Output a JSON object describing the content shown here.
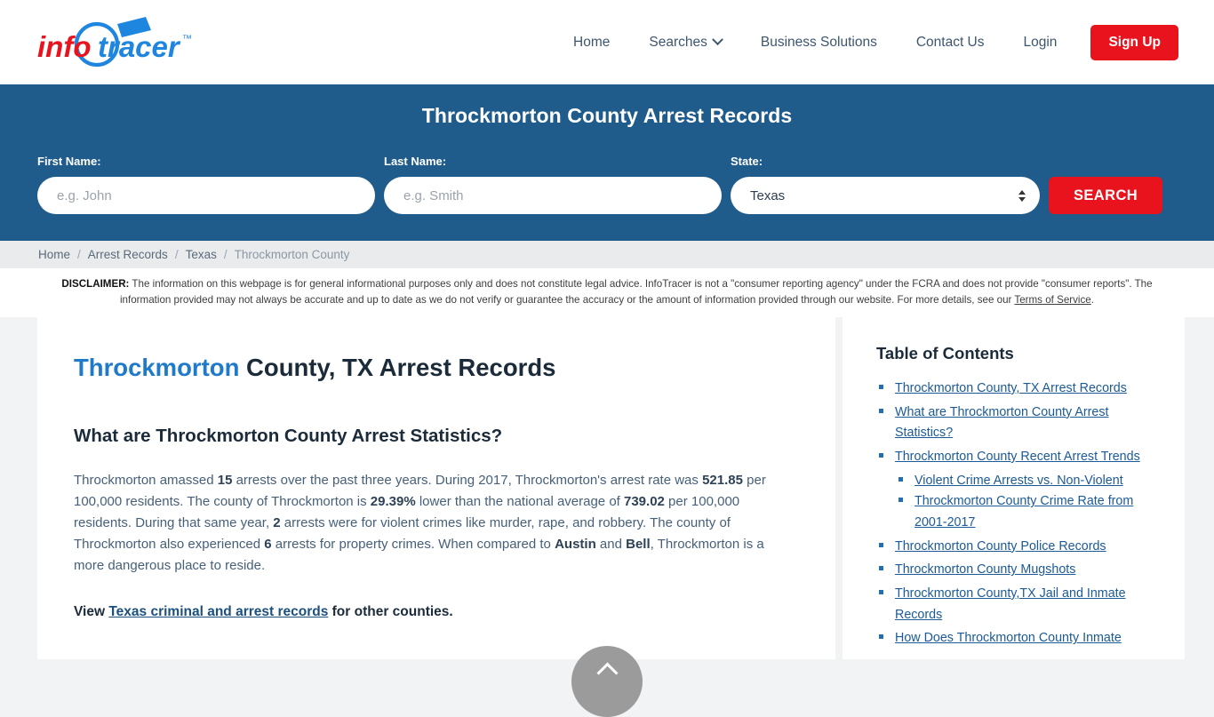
{
  "brand": {
    "name_part1": "info",
    "name_part2": "tracer",
    "trademark": "™",
    "color_red": "#e8131d",
    "color_blue": "#1f86e0"
  },
  "nav": {
    "items": [
      {
        "label": "Home",
        "has_caret": false
      },
      {
        "label": "Searches",
        "has_caret": true
      },
      {
        "label": "Business Solutions",
        "has_caret": false
      },
      {
        "label": "Contact Us",
        "has_caret": false
      },
      {
        "label": "Login",
        "has_caret": false
      }
    ],
    "signup_label": "Sign Up"
  },
  "hero": {
    "title": "Throckmorton County Arrest Records",
    "background_color": "#1f5c8b",
    "first_name": {
      "label": "First Name:",
      "value": "",
      "placeholder": "e.g. John"
    },
    "last_name": {
      "label": "Last Name:",
      "value": "",
      "placeholder": "e.g. Smith"
    },
    "state": {
      "label": "State:",
      "value": "Texas"
    },
    "search_label": "SEARCH"
  },
  "breadcrumb": {
    "items": [
      "Home",
      "Arrest Records",
      "Texas",
      "Throckmorton County"
    ],
    "separator": "/"
  },
  "disclaimer": {
    "label": "DISCLAIMER:",
    "text": " The information on this webpage is for general informational purposes only and does not constitute legal advice. InfoTracer is not a \"consumer reporting agency\" under the FCRA and does not provide \"consumer reports\". The information provided may not always be accurate and up to date as we do not verify or guarantee the accuracy or the amount of information provided through our website. For more details, see our ",
    "link": "Terms of Service",
    "tail": "."
  },
  "main": {
    "h1_highlight": "Throckmorton",
    "h1_rest": " County, TX Arrest Records",
    "h2": "What are Throckmorton County Arrest Statistics?",
    "paragraph_parts": [
      {
        "t": "Throckmorton amassed ",
        "b": false
      },
      {
        "t": "15",
        "b": true
      },
      {
        "t": " arrests over the past three years. During 2017, Throckmorton's arrest rate was ",
        "b": false
      },
      {
        "t": "521.85",
        "b": true
      },
      {
        "t": " per 100,000 residents. The county of Throckmorton is ",
        "b": false
      },
      {
        "t": "29.39%",
        "b": true
      },
      {
        "t": " lower than the national average of ",
        "b": false
      },
      {
        "t": "739.02",
        "b": true
      },
      {
        "t": " per 100,000 residents. During that same year, ",
        "b": false
      },
      {
        "t": "2",
        "b": true
      },
      {
        "t": " arrests were for violent crimes like murder, rape, and robbery. The county of Throckmorton also experienced ",
        "b": false
      },
      {
        "t": "6",
        "b": true
      },
      {
        "t": " arrests for property crimes. When compared to ",
        "b": false
      },
      {
        "t": "Austin",
        "b": true
      },
      {
        "t": " and ",
        "b": false
      },
      {
        "t": "Bell",
        "b": true
      },
      {
        "t": ", Throckmorton is a more dangerous place to reside.",
        "b": false
      }
    ],
    "view_prefix": "View ",
    "view_link": "Texas criminal and arrest records",
    "view_suffix": " for other counties."
  },
  "toc": {
    "title": "Table of Contents",
    "items": [
      {
        "label": "Throckmorton County, TX Arrest Records",
        "sub": []
      },
      {
        "label": "What are Throckmorton County Arrest Statistics?",
        "sub": []
      },
      {
        "label": "Throckmorton County Recent Arrest Trends",
        "sub": [
          {
            "label": "Violent Crime Arrests vs. Non-Violent"
          },
          {
            "label": "Throckmorton County Crime Rate from 2001-2017"
          }
        ]
      },
      {
        "label": "Throckmorton County Police Records",
        "sub": []
      },
      {
        "label": "Throckmorton County Mugshots",
        "sub": []
      },
      {
        "label": "Throckmorton County,TX Jail and Inmate Records",
        "sub": []
      },
      {
        "label": "How Does Throckmorton County Inmate",
        "sub": []
      }
    ]
  },
  "scroll_top": {
    "icon": "chevron-up-icon"
  }
}
